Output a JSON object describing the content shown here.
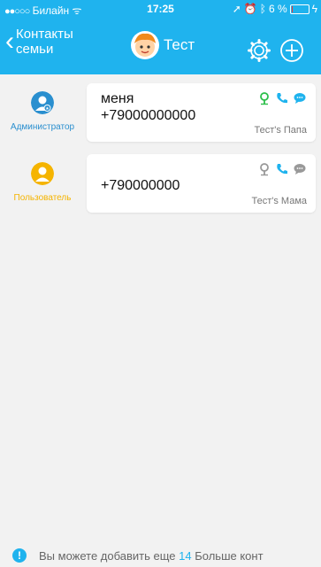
{
  "status": {
    "carrier": "Билайн",
    "time": "17:25",
    "battery": "6 %",
    "battery_level": 0.06
  },
  "nav": {
    "back_line1": "Контакты",
    "back_line2": "семьи",
    "title": "Тест"
  },
  "contacts": [
    {
      "role": "Администратор",
      "role_color": "#2a8fcf",
      "name": "меня",
      "phone": "+79000000000",
      "relation": "Тест's Папа",
      "location_active": true
    },
    {
      "role": "Пользователь",
      "role_color": "#f5b400",
      "name": "",
      "phone": "+790000000",
      "relation": "Тест's Мама",
      "location_active": false
    }
  ],
  "footer": {
    "text_before": "Вы можете добавить еще",
    "count": "14",
    "text_after": "Больше конт"
  },
  "colors": {
    "accent": "#1fb3ee",
    "green": "#2bbf4a",
    "admin": "#2a8fcf",
    "user": "#f5b400"
  }
}
